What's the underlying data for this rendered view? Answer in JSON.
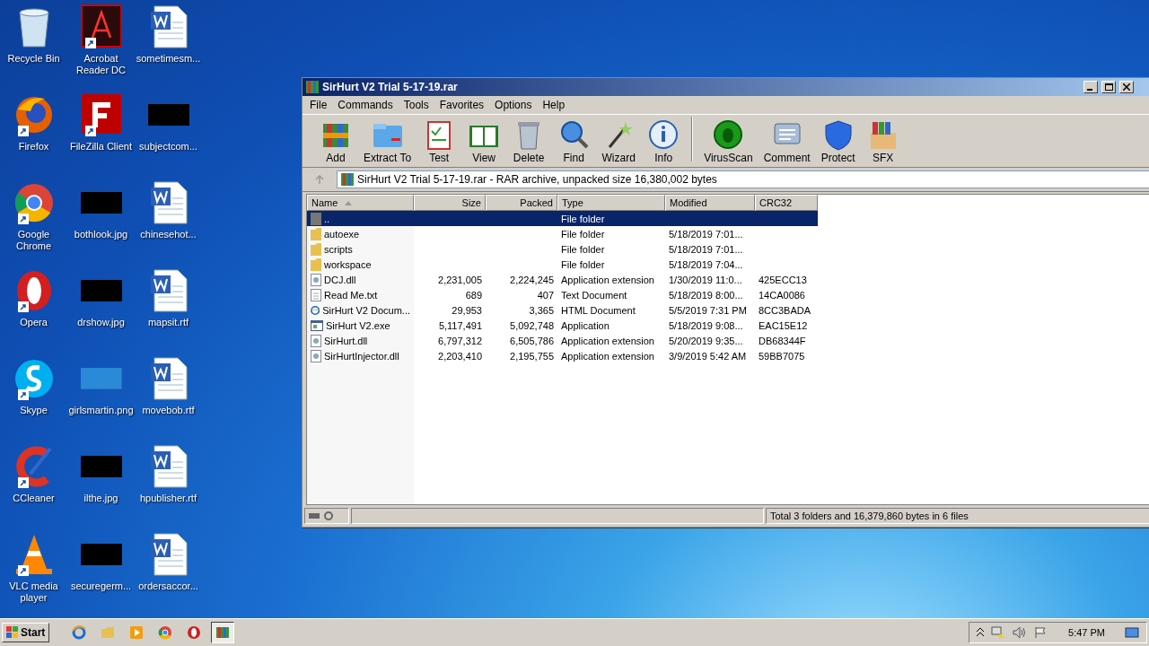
{
  "desktop": {
    "icons": [
      {
        "label": "Recycle Bin",
        "kind": "recycle",
        "shortcut": false
      },
      {
        "label": "Acrobat Reader DC",
        "kind": "app",
        "shortcut": true
      },
      {
        "label": "sometimesm...",
        "kind": "document",
        "shortcut": false
      },
      {
        "label": "Firefox",
        "kind": "app",
        "shortcut": true
      },
      {
        "label": "FileZilla Client",
        "kind": "app",
        "shortcut": true
      },
      {
        "label": "subjectcom...",
        "kind": "image",
        "shortcut": false
      },
      {
        "label": "Google Chrome",
        "kind": "app",
        "shortcut": true
      },
      {
        "label": "bothlook.jpg",
        "kind": "image",
        "shortcut": false
      },
      {
        "label": "chinesehot...",
        "kind": "document",
        "shortcut": false
      },
      {
        "label": "Opera",
        "kind": "app",
        "shortcut": true
      },
      {
        "label": "drshow.jpg",
        "kind": "image",
        "shortcut": false
      },
      {
        "label": "mapsit.rtf",
        "kind": "document",
        "shortcut": false
      },
      {
        "label": "Skype",
        "kind": "app",
        "shortcut": true
      },
      {
        "label": "girlsmartin.png",
        "kind": "blank",
        "shortcut": false
      },
      {
        "label": "movebob.rtf",
        "kind": "document",
        "shortcut": false
      },
      {
        "label": "CCleaner",
        "kind": "app",
        "shortcut": true
      },
      {
        "label": "ilthe.jpg",
        "kind": "image",
        "shortcut": false
      },
      {
        "label": "hpublisher.rtf",
        "kind": "document",
        "shortcut": false
      },
      {
        "label": "VLC media player",
        "kind": "app",
        "shortcut": true
      },
      {
        "label": "securegerm...",
        "kind": "image",
        "shortcut": false
      },
      {
        "label": "ordersaccor...",
        "kind": "document",
        "shortcut": false
      }
    ]
  },
  "window": {
    "title": "SirHurt V2 Trial 5-17-19.rar",
    "menu": [
      "File",
      "Commands",
      "Tools",
      "Favorites",
      "Options",
      "Help"
    ],
    "toolbar_groups": [
      {
        "buttons": [
          "Add",
          "Extract To",
          "Test",
          "View",
          "Delete",
          "Find",
          "Wizard",
          "Info"
        ]
      },
      {
        "buttons": [
          "VirusScan",
          "Comment",
          "Protect",
          "SFX"
        ]
      }
    ],
    "path": "SirHurt V2 Trial 5-17-19.rar - RAR archive, unpacked size 16,380,002 bytes",
    "table": {
      "columns": [
        "Name",
        "Size",
        "Packed",
        "Type",
        "Modified",
        "CRC32"
      ],
      "rows": [
        {
          "kind": "up",
          "name": "..",
          "size": "",
          "packed": "",
          "type": "File folder",
          "modified": "",
          "crc": "",
          "selected": true
        },
        {
          "kind": "folder",
          "name": "autoexe",
          "size": "",
          "packed": "",
          "type": "File folder",
          "modified": "5/18/2019 7:01...",
          "crc": "",
          "selected": false
        },
        {
          "kind": "folder",
          "name": "scripts",
          "size": "",
          "packed": "",
          "type": "File folder",
          "modified": "5/18/2019 7:01...",
          "crc": "",
          "selected": false
        },
        {
          "kind": "folder",
          "name": "workspace",
          "size": "",
          "packed": "",
          "type": "File folder",
          "modified": "5/18/2019 7:04...",
          "crc": "",
          "selected": false
        },
        {
          "kind": "dll",
          "name": "DCJ.dll",
          "size": "2,231,005",
          "packed": "2,224,245",
          "type": "Application extension",
          "modified": "1/30/2019 11:0...",
          "crc": "425ECC13",
          "selected": false
        },
        {
          "kind": "text",
          "name": "Read Me.txt",
          "size": "689",
          "packed": "407",
          "type": "Text Document",
          "modified": "5/18/2019 8:00...",
          "crc": "14CA0086",
          "selected": false
        },
        {
          "kind": "html",
          "name": "SirHurt V2 Docum...",
          "size": "29,953",
          "packed": "3,365",
          "type": "HTML Document",
          "modified": "5/5/2019 7:31 PM",
          "crc": "8CC3BADA",
          "selected": false
        },
        {
          "kind": "exe",
          "name": "SirHurt V2.exe",
          "size": "5,117,491",
          "packed": "5,092,748",
          "type": "Application",
          "modified": "5/18/2019 9:08...",
          "crc": "EAC15E12",
          "selected": false
        },
        {
          "kind": "dll",
          "name": "SirHurt.dll",
          "size": "6,797,312",
          "packed": "6,505,786",
          "type": "Application extension",
          "modified": "5/20/2019 9:35...",
          "crc": "DB68344F",
          "selected": false
        },
        {
          "kind": "dll",
          "name": "SirHurtInjector.dll",
          "size": "2,203,410",
          "packed": "2,195,755",
          "type": "Application extension",
          "modified": "3/9/2019 5:42 AM",
          "crc": "59BB7075",
          "selected": false
        }
      ]
    },
    "status": "Total 3 folders and 16,379,860 bytes in 6 files"
  },
  "taskbar": {
    "start": "Start",
    "apps": [
      {
        "active": false
      },
      {
        "active": false
      },
      {
        "active": false
      },
      {
        "active": false
      },
      {
        "active": false
      },
      {
        "active": true
      }
    ],
    "clock": "5:47 PM"
  }
}
